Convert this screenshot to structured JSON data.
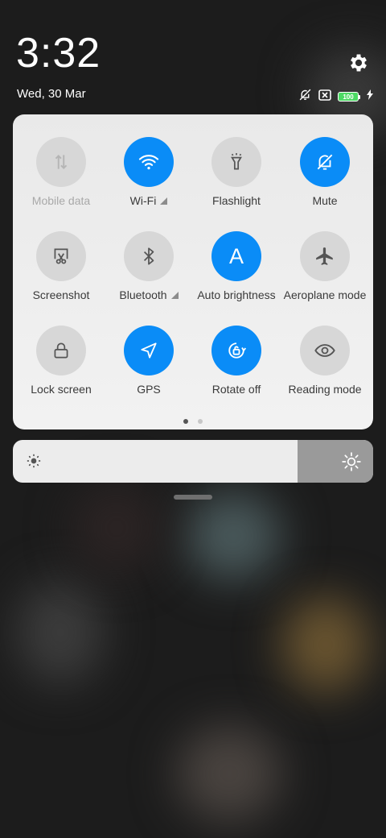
{
  "status": {
    "time": "3:32",
    "date": "Wed, 30 Mar",
    "battery_level": "100",
    "icons": [
      "alarm-off-icon",
      "no-sim-icon",
      "battery-icon",
      "charging-icon"
    ]
  },
  "header": {
    "settings_icon": "gear-icon"
  },
  "toggles": [
    {
      "label": "Mobile data",
      "state": "disabled",
      "icon": "mobile-data-icon"
    },
    {
      "label": "Wi-Fi",
      "state": "on",
      "icon": "wifi-icon",
      "expandable": true
    },
    {
      "label": "Flashlight",
      "state": "off",
      "icon": "flashlight-icon"
    },
    {
      "label": "Mute",
      "state": "on",
      "icon": "bell-off-icon"
    },
    {
      "label": "Screenshot",
      "state": "off",
      "icon": "screenshot-icon"
    },
    {
      "label": "Bluetooth",
      "state": "off",
      "icon": "bluetooth-icon",
      "expandable": true
    },
    {
      "label": "Auto brightness",
      "state": "on",
      "icon": "auto-brightness-icon",
      "glyph": "A"
    },
    {
      "label": "Aeroplane mode",
      "state": "off",
      "icon": "airplane-icon"
    },
    {
      "label": "Lock screen",
      "state": "off",
      "icon": "lock-icon"
    },
    {
      "label": "GPS",
      "state": "on",
      "icon": "location-arrow-icon"
    },
    {
      "label": "Rotate off",
      "state": "on",
      "icon": "rotation-lock-icon"
    },
    {
      "label": "Reading mode",
      "state": "off",
      "icon": "eye-icon"
    }
  ],
  "pager": {
    "pages": 2,
    "current": 1
  },
  "brightness": {
    "level": 0.79
  },
  "colors": {
    "accent": "#0a8cf7",
    "tile_off": "#d7d7d7",
    "panel": "#eeeeee"
  }
}
